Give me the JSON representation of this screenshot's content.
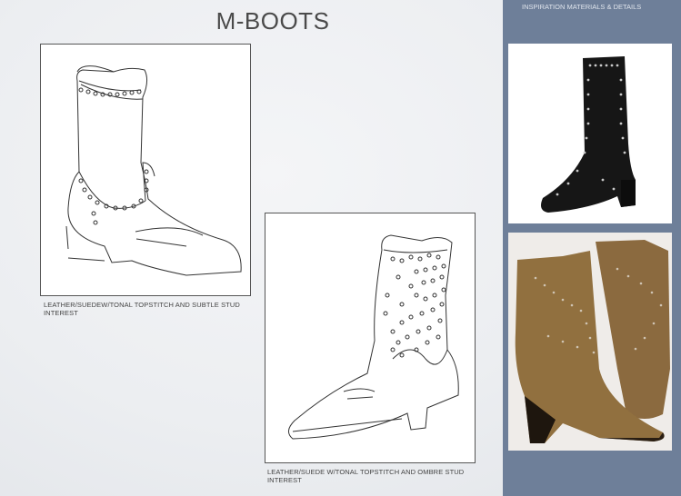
{
  "page": {
    "title": "M-BOOTS"
  },
  "sketches": [
    {
      "caption": "LEATHER/SUEDEW/TONAL TOPSTITCH AND SUBTLE STUD INTEREST"
    },
    {
      "caption": "LEATHER/SUEDE W/TONAL TOPSTITCH AND OMBRE STUD INTEREST"
    }
  ],
  "inspiration": {
    "title": "INSPIRATION MATERIALS & DETAILS",
    "photos": [
      {
        "subject": "black studded leather boot",
        "color": "#1a1a1a"
      },
      {
        "subject": "tan studded suede western boots",
        "color": "#8a6a3e"
      }
    ]
  },
  "colors": {
    "panel": "#6e7f99",
    "title": "#4a4a4a"
  }
}
